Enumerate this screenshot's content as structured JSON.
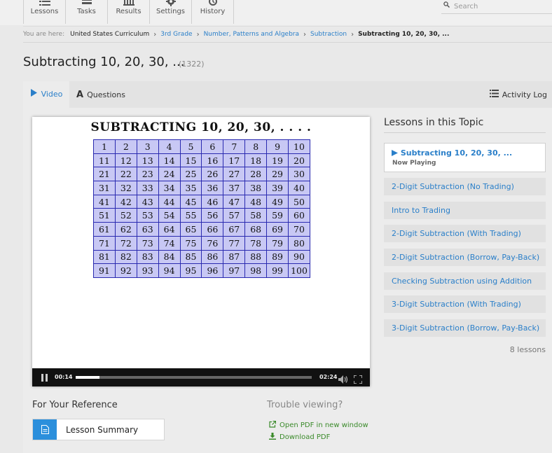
{
  "nav": {
    "items": [
      {
        "label": "Lessons",
        "icon": "list-icon"
      },
      {
        "label": "Tasks",
        "icon": "tasks-icon"
      },
      {
        "label": "Results",
        "icon": "bar-chart-icon"
      },
      {
        "label": "Settings",
        "icon": "gear-icon"
      },
      {
        "label": "History",
        "icon": "history-icon"
      }
    ],
    "search_placeholder": "Search"
  },
  "breadcrumb": {
    "prefix": "You are here:",
    "items": [
      "United States Curriculum",
      "3rd Grade",
      "Number, Patterns and Algebra",
      "Subtraction"
    ],
    "current": "Subtracting 10, 20, 30, ..."
  },
  "page": {
    "title": "Subtracting 10, 20, 30, ...",
    "count": "(1322)"
  },
  "tabs": {
    "video": "Video",
    "questions": "Questions",
    "activity_log": "Activity Log"
  },
  "video": {
    "slide_title": "SUBTRACTING 10, 20, 30, . . . .",
    "grid": [
      [
        "1",
        "2",
        "3",
        "4",
        "5",
        "6",
        "7",
        "8",
        "9",
        "10"
      ],
      [
        "11",
        "12",
        "13",
        "14",
        "15",
        "16",
        "17",
        "18",
        "19",
        "20"
      ],
      [
        "21",
        "22",
        "23",
        "24",
        "25",
        "26",
        "27",
        "28",
        "29",
        "30"
      ],
      [
        "31",
        "32",
        "33",
        "34",
        "35",
        "36",
        "37",
        "38",
        "39",
        "40"
      ],
      [
        "41",
        "42",
        "43",
        "44",
        "45",
        "46",
        "47",
        "48",
        "49",
        "50"
      ],
      [
        "51",
        "52",
        "53",
        "54",
        "55",
        "56",
        "57",
        "58",
        "59",
        "60"
      ],
      [
        "61",
        "62",
        "63",
        "64",
        "65",
        "66",
        "67",
        "68",
        "69",
        "70"
      ],
      [
        "71",
        "72",
        "73",
        "74",
        "75",
        "76",
        "77",
        "78",
        "79",
        "80"
      ],
      [
        "81",
        "82",
        "83",
        "84",
        "85",
        "86",
        "87",
        "88",
        "89",
        "90"
      ],
      [
        "91",
        "92",
        "93",
        "94",
        "95",
        "96",
        "97",
        "98",
        "99",
        "100"
      ]
    ],
    "current_time": "00:14",
    "total_time": "02:24",
    "progress": 0.1
  },
  "reference": {
    "heading": "For Your Reference",
    "lesson_summary": "Lesson Summary"
  },
  "trouble": {
    "heading": "Trouble viewing?",
    "open_pdf": "Open PDF in new window",
    "download_pdf": "Download PDF"
  },
  "lessons": {
    "heading": "Lessons in this Topic",
    "active": {
      "title": "Subtracting 10, 20, 30, ...",
      "status": "Now Playing"
    },
    "items": [
      "2-Digit Subtraction (No Trading)",
      "Intro to Trading",
      "2-Digit Subtraction (With Trading)",
      "2-Digit Subtraction (Borrow, Pay-Back)",
      "Checking Subtraction using Addition",
      "3-Digit Subtraction (With Trading)",
      "3-Digit Subtraction (Borrow, Pay-Back)"
    ],
    "count": "8 lessons"
  },
  "colors": {
    "accent": "#2a7fc9",
    "download_green": "#3a8a2a",
    "grid_fill": "#c8c8f4",
    "grid_border": "#2a2ab0"
  }
}
